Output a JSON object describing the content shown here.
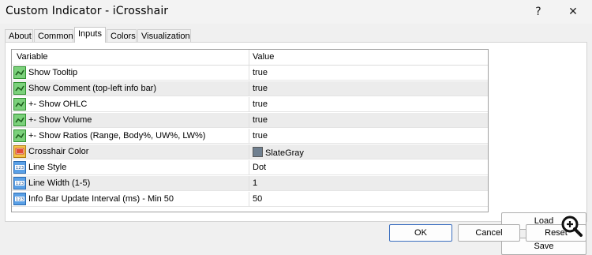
{
  "window": {
    "title": "Custom Indicator - iCrosshair",
    "help_glyph": "?",
    "close_glyph": "✕"
  },
  "tabs": [
    {
      "label": "About"
    },
    {
      "label": "Common"
    },
    {
      "label": "Inputs"
    },
    {
      "label": "Colors"
    },
    {
      "label": "Visualization"
    }
  ],
  "active_tab": "Inputs",
  "grid": {
    "columns": [
      "Variable",
      "Value"
    ],
    "rows": [
      {
        "icon": "bool-icon",
        "name": "Show Tooltip",
        "value": "true"
      },
      {
        "icon": "bool-icon",
        "name": "Show Comment (top-left info bar)",
        "value": "true"
      },
      {
        "icon": "bool-icon",
        "name": "+- Show OHLC",
        "value": "true"
      },
      {
        "icon": "bool-icon",
        "name": "+- Show Volume",
        "value": "true"
      },
      {
        "icon": "bool-icon",
        "name": "+- Show Ratios (Range, Body%, UW%, LW%)",
        "value": "true"
      },
      {
        "icon": "color-icon",
        "name": "Crosshair Color",
        "value": "SlateGray",
        "swatch": "#708090"
      },
      {
        "icon": "int-icon",
        "name": "Line Style",
        "value": "Dot"
      },
      {
        "icon": "int-icon",
        "name": "Line Width (1-5)",
        "value": "1"
      },
      {
        "icon": "int-icon",
        "name": "Info Bar Update Interval (ms) - Min 50",
        "value": "50"
      }
    ]
  },
  "buttons": {
    "load": "Load",
    "save": "Save",
    "ok": "OK",
    "cancel": "Cancel",
    "reset": "Reset"
  }
}
